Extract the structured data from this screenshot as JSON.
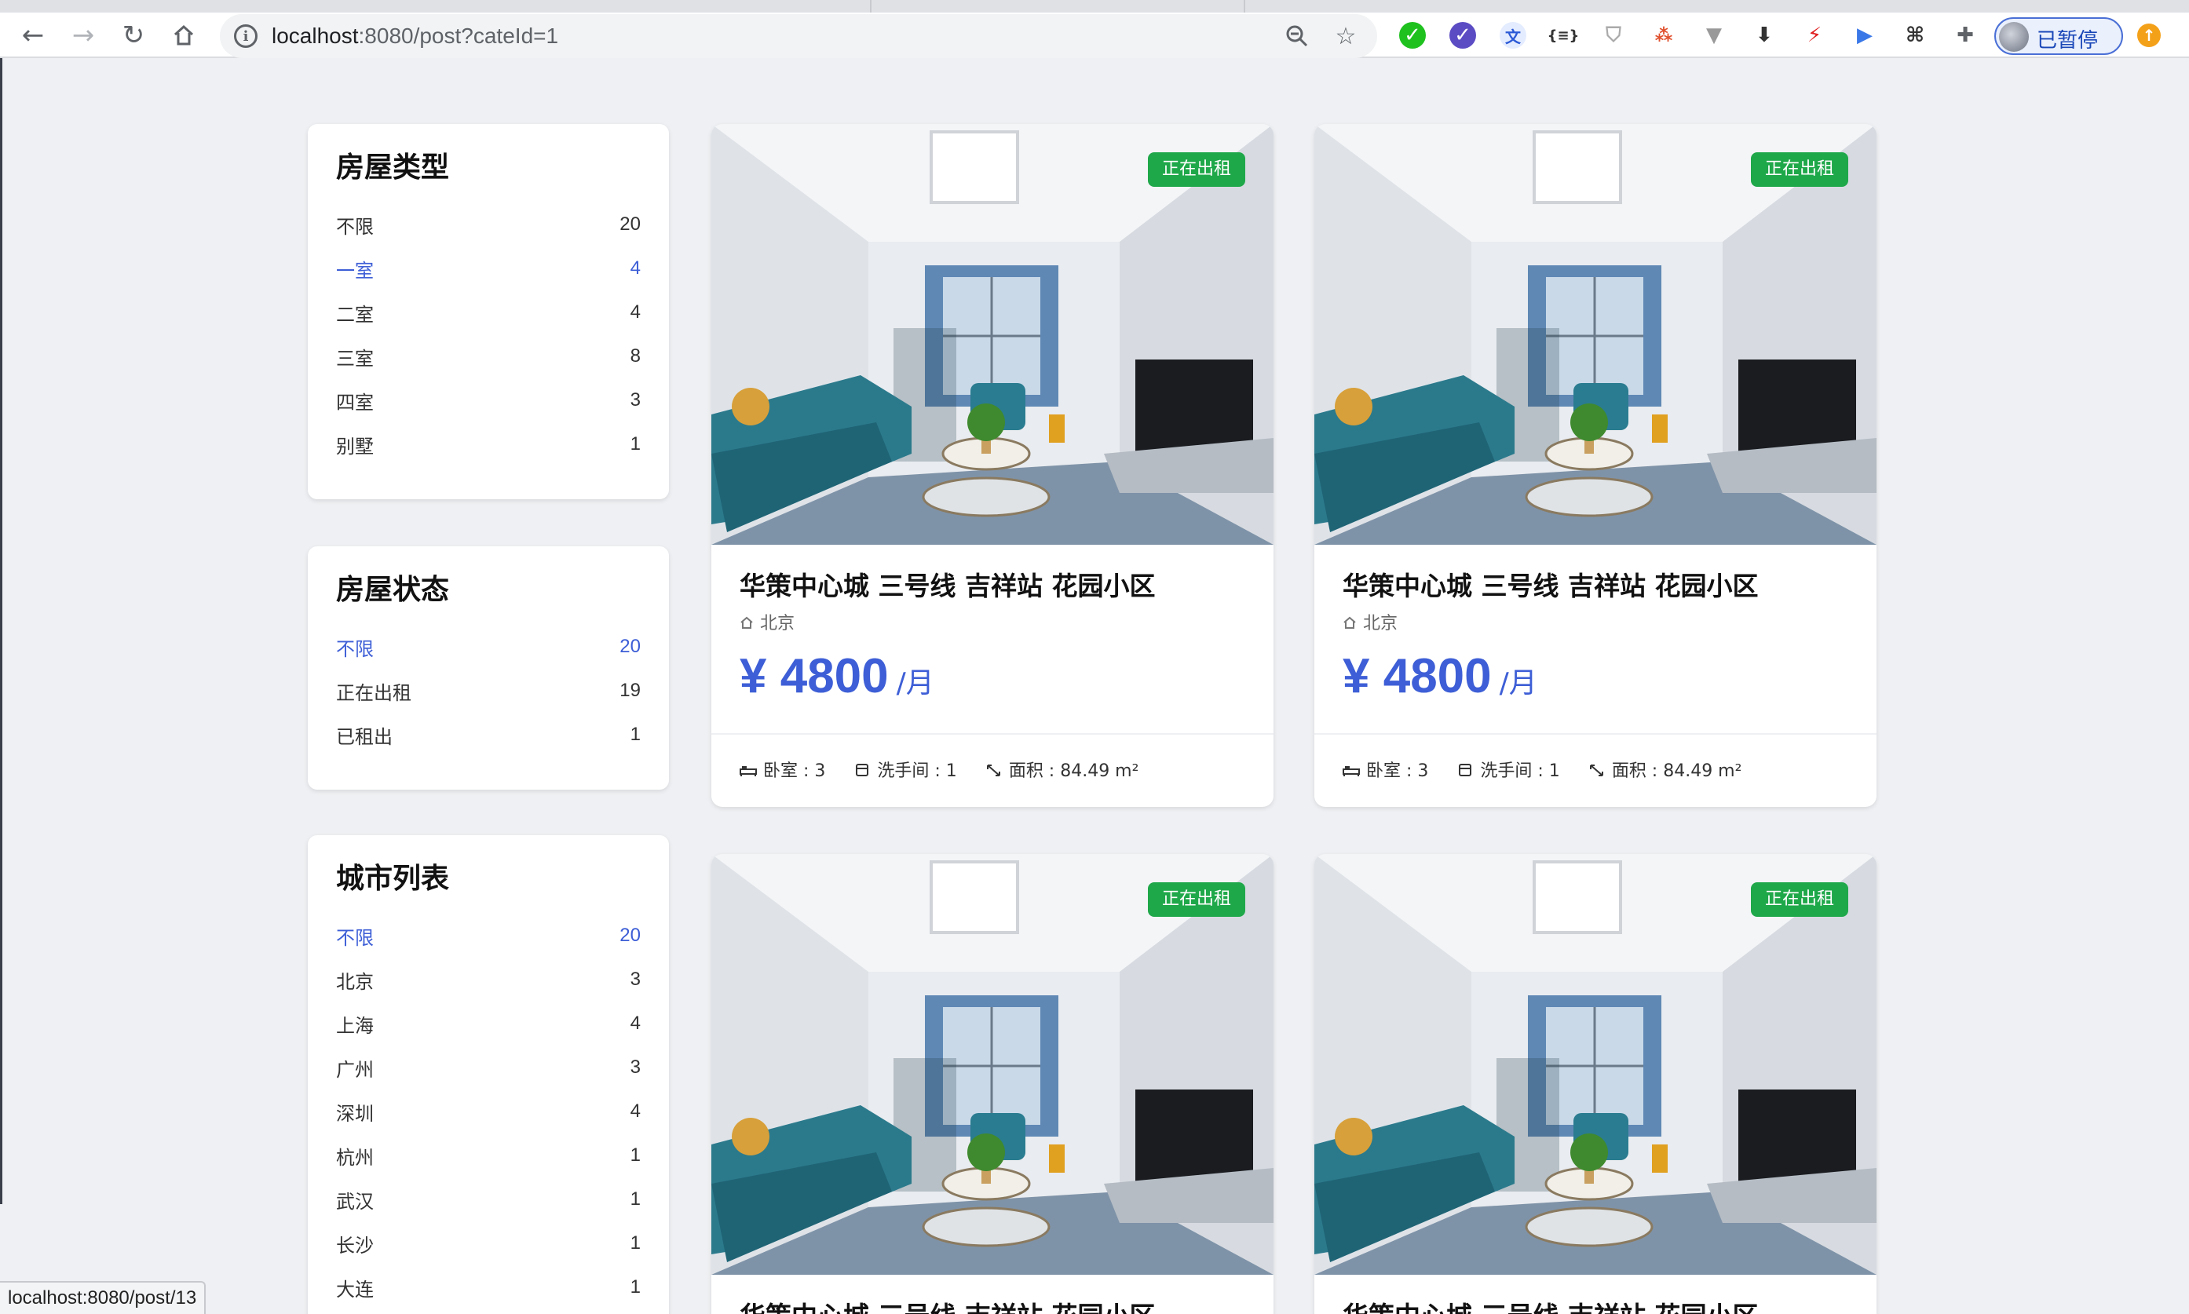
{
  "browser": {
    "url_host": "localhost",
    "url_path": ":8080/post?cateId=1",
    "profile_label": "已暂停",
    "extensions": [
      "green-circle-icon",
      "blue-shield-icon",
      "translate-icon",
      "json-braces-icon",
      "shield-outline-icon",
      "network-icon",
      "vue-icon",
      "download-arrow-icon",
      "red-bolt-icon",
      "play-icon",
      "chatgpt-icon",
      "puzzle-icon"
    ],
    "json_ext_text": "{≡}"
  },
  "filters": [
    {
      "title": "房屋类型",
      "items": [
        {
          "label": "不限",
          "count": "20",
          "active": false
        },
        {
          "label": "一室",
          "count": "4",
          "active": true
        },
        {
          "label": "二室",
          "count": "4",
          "active": false
        },
        {
          "label": "三室",
          "count": "8",
          "active": false
        },
        {
          "label": "四室",
          "count": "3",
          "active": false
        },
        {
          "label": "别墅",
          "count": "1",
          "active": false
        }
      ]
    },
    {
      "title": "房屋状态",
      "items": [
        {
          "label": "不限",
          "count": "20",
          "active": true
        },
        {
          "label": "正在出租",
          "count": "19",
          "active": false
        },
        {
          "label": "已租出",
          "count": "1",
          "active": false
        }
      ]
    },
    {
      "title": "城市列表",
      "items": [
        {
          "label": "不限",
          "count": "20",
          "active": true
        },
        {
          "label": "北京",
          "count": "3",
          "active": false
        },
        {
          "label": "上海",
          "count": "4",
          "active": false
        },
        {
          "label": "广州",
          "count": "3",
          "active": false
        },
        {
          "label": "深圳",
          "count": "4",
          "active": false
        },
        {
          "label": "杭州",
          "count": "1",
          "active": false
        },
        {
          "label": "武汉",
          "count": "1",
          "active": false
        },
        {
          "label": "长沙",
          "count": "1",
          "active": false
        },
        {
          "label": "大连",
          "count": "1",
          "active": false
        }
      ]
    }
  ],
  "listings": [
    {
      "badge": "正在出租",
      "title": "华策中心城 三号线 吉祥站 花园小区",
      "city": "北京",
      "price": "¥ 4800",
      "unit": "/月",
      "bedrooms": "卧室 : 3",
      "bathrooms": "洗手间 : 1",
      "area": "面积 : 84.49 m²"
    },
    {
      "badge": "正在出租",
      "title": "华策中心城 三号线 吉祥站 花园小区",
      "city": "北京",
      "price": "¥ 4800",
      "unit": "/月",
      "bedrooms": "卧室 : 3",
      "bathrooms": "洗手间 : 1",
      "area": "面积 : 84.49 m²"
    },
    {
      "badge": "正在出租",
      "title": "华策中心城 三号线 吉祥站 花园小区"
    },
    {
      "badge": "正在出租",
      "title": "华策中心城 三号线 吉祥站 花园小区"
    }
  ],
  "status_bar": "localhost:8080/post/13"
}
